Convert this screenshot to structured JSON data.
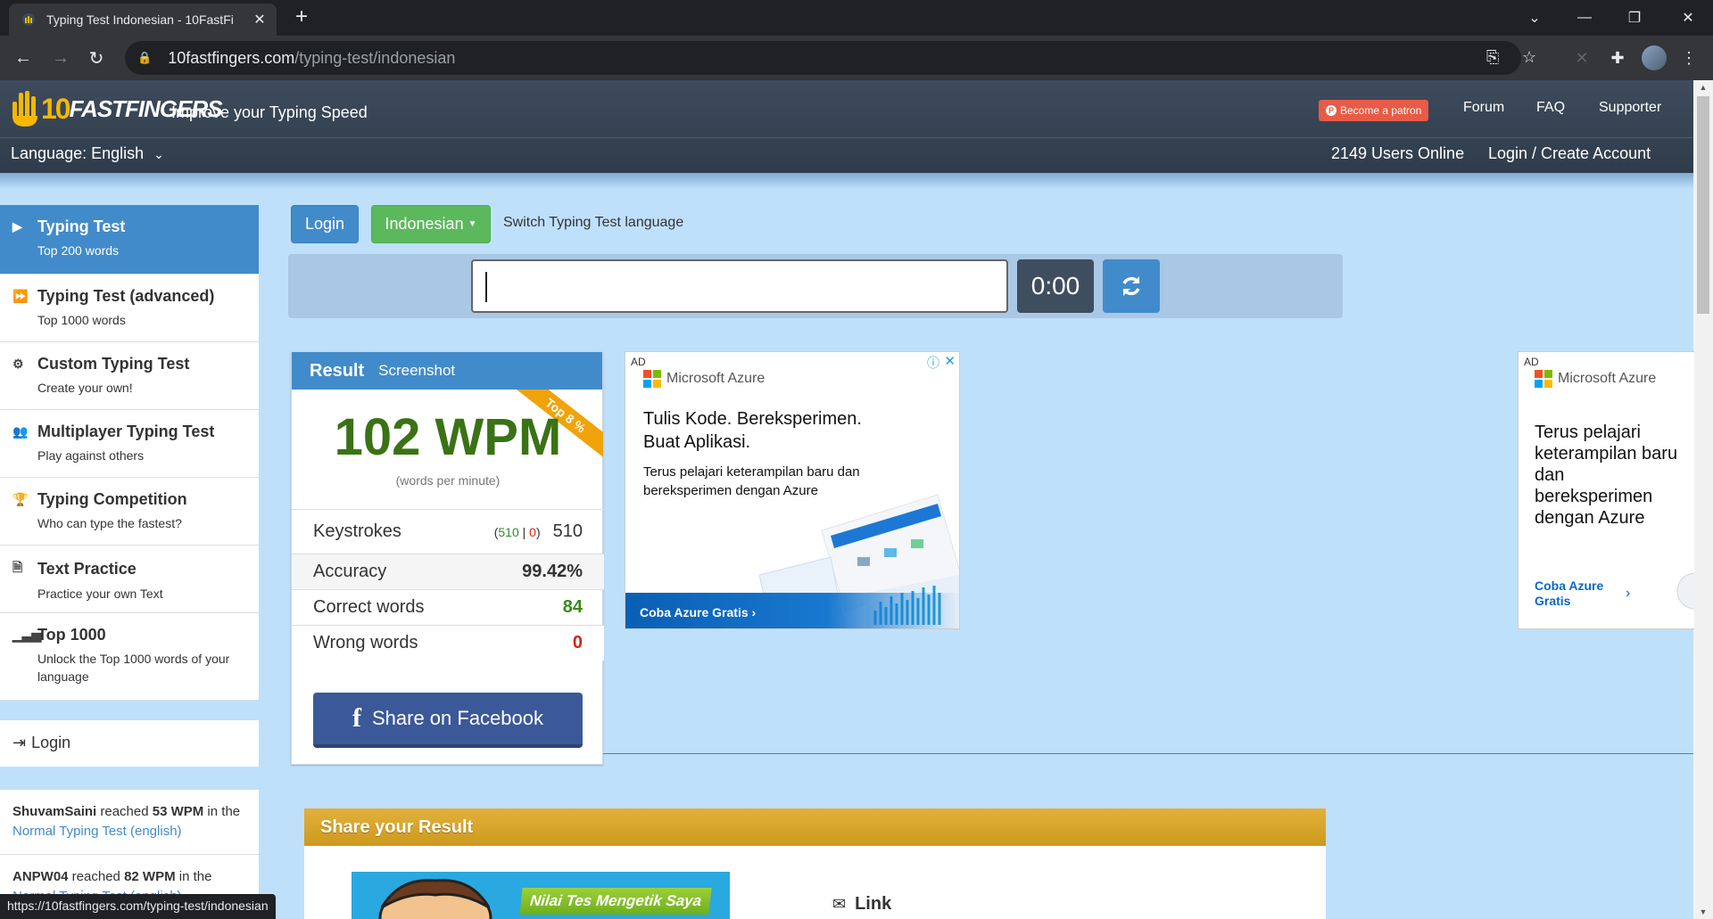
{
  "browser": {
    "tab_title": "Typing Test Indonesian - 10FastFi",
    "url_host": "10fastfingers.com",
    "url_path": "/typing-test/indonesian",
    "status_url": "https://10fastfingers.com/typing-test/indonesian"
  },
  "header": {
    "logo_ten": "10",
    "logo_text": "FASTFINGERS",
    "tagline": "Improve your Typing Speed",
    "patron_label": "Become a patron",
    "nav": [
      "Forum",
      "FAQ",
      "Supporter"
    ],
    "language_label": "Language: English",
    "users_online": "2149 Users Online",
    "login_create": "Login / Create Account"
  },
  "sidebar": {
    "items": [
      {
        "title": "Typing Test",
        "sub": "Top 200 words",
        "icon": "play-icon"
      },
      {
        "title": "Typing Test (advanced)",
        "sub": "Top 1000 words",
        "icon": "fast-forward-icon"
      },
      {
        "title": "Custom Typing Test",
        "sub": "Create your own!",
        "icon": "gears-icon"
      },
      {
        "title": "Multiplayer Typing Test",
        "sub": "Play against others",
        "icon": "users-icon"
      },
      {
        "title": "Typing Competition",
        "sub": "Who can type the fastest?",
        "icon": "trophy-icon"
      },
      {
        "title": "Text Practice",
        "sub": "Practice your own Text",
        "icon": "document-icon"
      },
      {
        "title": "Top 1000",
        "sub": "Unlock the Top 1000 words of your language",
        "icon": "signal-bars-icon"
      }
    ],
    "login_label": "Login",
    "feed": [
      {
        "user": "ShuvamSaini",
        "text1": " reached ",
        "wpm": "53 WPM",
        "text2": " in the ",
        "link": "Normal Typing Test (english)"
      },
      {
        "user": "ANPW04",
        "text1": " reached ",
        "wpm": "82 WPM",
        "text2": " in the ",
        "link": "Normal Typing Test (english)"
      }
    ]
  },
  "controls": {
    "login_button": "Login",
    "language_button": "Indonesian",
    "switch_text": "Switch Typing Test language",
    "timer": "0:00"
  },
  "result": {
    "title": "Result",
    "screenshot_label": "Screenshot",
    "ribbon": "Top 8 %",
    "wpm": "102 WPM",
    "wpm_sub": "(words per minute)",
    "keystrokes_label": "Keystrokes",
    "keystrokes_correct": "510",
    "keystrokes_sep": " | ",
    "keystrokes_wrong": "0",
    "keystrokes_total": "510",
    "accuracy_label": "Accuracy",
    "accuracy": "99.42%",
    "correct_label": "Correct words",
    "correct": "84",
    "wrong_label": "Wrong words",
    "wrong": "0",
    "facebook_label": "Share on Facebook"
  },
  "ads": {
    "ad1": {
      "label": "AD",
      "brand": "Microsoft Azure",
      "headline": "Tulis Kode. Bereksperimen. Buat Aplikasi.",
      "body": "Terus pelajari keterampilan baru dan bereksperimen dengan Azure",
      "cta": "Coba Azure Gratis ›"
    },
    "ad2": {
      "label": "AD",
      "brand": "Microsoft Azure",
      "headline": "Terus pelajari keterampilan baru dan bereksperimen dengan Azure",
      "cta": "Coba Azure Gratis"
    }
  },
  "share": {
    "title": "Share your Result",
    "image_label": "Nilai Tes Mengetik Saya",
    "link_label": "Link"
  },
  "colors": {
    "primary": "#428bca",
    "success": "#5cb85c",
    "wpm_green": "#3a7215",
    "facebook": "#3b5998",
    "share_gold": "#d9a52b"
  }
}
